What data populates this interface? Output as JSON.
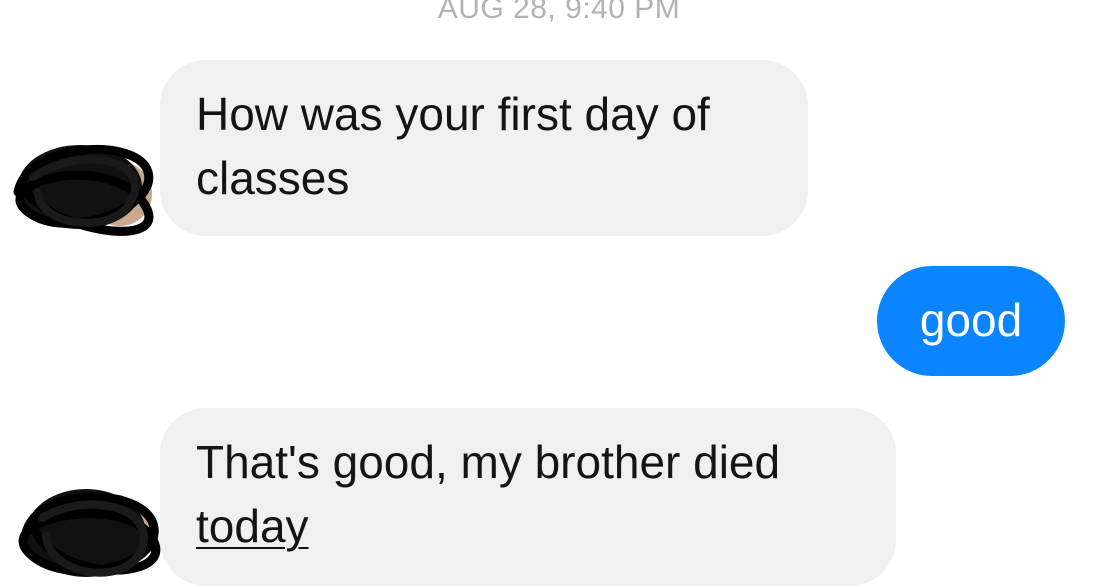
{
  "conversation": {
    "timestamp": "AUG 28, 9:40 PM",
    "messages": [
      {
        "direction": "incoming",
        "text": "How was your first day of classes"
      },
      {
        "direction": "outgoing",
        "text": "good"
      },
      {
        "direction": "incoming",
        "text_main": "That's good, my brother died",
        "text_link": "today"
      }
    ]
  },
  "colors": {
    "incoming_bubble": "#f1f0f0",
    "outgoing_bubble": "#0a84ff",
    "timestamp": "#b3b3b3"
  }
}
